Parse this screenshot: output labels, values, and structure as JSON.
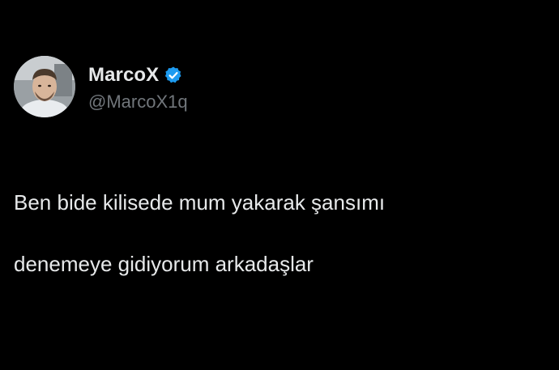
{
  "author": {
    "display_name": "MarcoX",
    "handle": "@MarcoX1q",
    "verified": true,
    "verified_icon": "verified-badge-icon",
    "verified_color": "#1d9bf0"
  },
  "tweet": {
    "line1": "Ben bide kilisede mum yakarak şansımı",
    "line2": "denemeye gidiyorum arkadaşlar"
  },
  "colors": {
    "background": "#000000",
    "text": "#e7e9ea",
    "handle": "#71767b"
  }
}
